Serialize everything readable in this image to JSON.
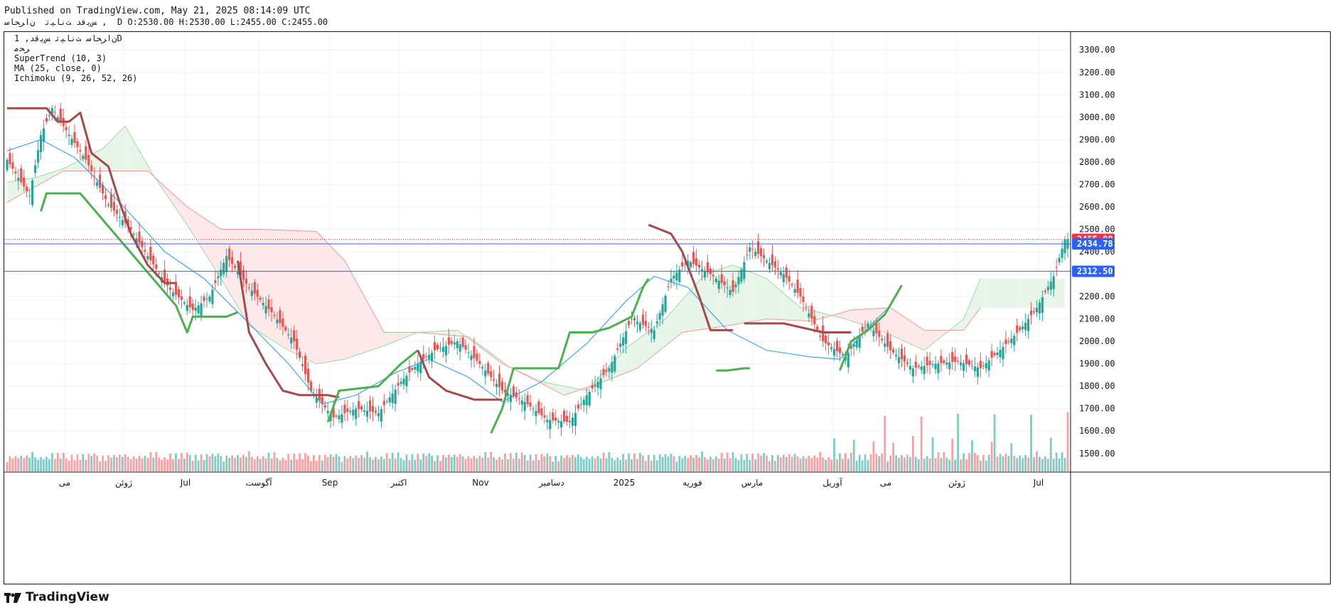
{
  "header": {
    "published": "Published on TradingView.com, May 21, 2025 08:14:09 UTC",
    "subline": "ﺲﯾﻗﺪ ﺖﻧﺎﯿﺗ  ﻥاﺮﺤﺎﺳ ,  D O:2530.00 H:2530.00 L:2455.00 C:2455.00"
  },
  "legend": {
    "symbol": "ﻥاﺮﺤﺎﺳ ﺖﻧﺎﯿﺗ ﺲﯾﻗﺪ, 1D",
    "exchange": "ﺮﺤﻣ",
    "supertrend": "SuperTrend (10, 3)",
    "ma": "MA (25, close, 0)",
    "ichimoku": "Ichimoku (9, 26, 52, 26)"
  },
  "brand": {
    "name": "TradingView"
  },
  "chart_data": {
    "type": "candlestick",
    "timeframe": "1D",
    "ylim": [
      1420,
      3380
    ],
    "y_ticks": [
      1500,
      1600,
      1700,
      1800,
      1900,
      2000,
      2100,
      2200,
      2300,
      2400,
      2500,
      2600,
      2700,
      2800,
      2900,
      3000,
      3100,
      3200,
      3300
    ],
    "x_month_labels": [
      "می",
      "ژوئن",
      "Jul",
      "آگوست",
      "Sep",
      "اکتبر",
      "Nov",
      "دسامبر",
      "2025",
      "فوریه",
      "مارس",
      "آوریل",
      "می",
      "ژوئن",
      "Jul"
    ],
    "price_labels": [
      {
        "value": 2455.0,
        "text": "2455.00",
        "color": "#f23645"
      },
      {
        "value": 2434.78,
        "text": "2434.78",
        "color": "#2962ff"
      },
      {
        "value": 2312.5,
        "text": "2312.50",
        "color": "#2962ff"
      }
    ],
    "horizontal_lines": [
      2434.78,
      2312.5
    ],
    "last_close": 2455.0,
    "ohlc_last": {
      "open": 2530.0,
      "high": 2530.0,
      "low": 2455.0,
      "close": 2455.0
    },
    "candle_close_path": [
      [
        0,
        2810
      ],
      [
        8,
        2650
      ],
      [
        12,
        2920
      ],
      [
        16,
        3040
      ],
      [
        20,
        2960
      ],
      [
        28,
        2810
      ],
      [
        36,
        2610
      ],
      [
        44,
        2500
      ],
      [
        50,
        2380
      ],
      [
        58,
        2230
      ],
      [
        66,
        2140
      ],
      [
        72,
        2200
      ],
      [
        78,
        2380
      ],
      [
        86,
        2240
      ],
      [
        94,
        2130
      ],
      [
        102,
        2000
      ],
      [
        108,
        1780
      ],
      [
        116,
        1660
      ],
      [
        124,
        1700
      ],
      [
        132,
        1680
      ],
      [
        140,
        1820
      ],
      [
        146,
        1900
      ],
      [
        152,
        1960
      ],
      [
        160,
        2000
      ],
      [
        168,
        1900
      ],
      [
        176,
        1780
      ],
      [
        184,
        1730
      ],
      [
        192,
        1650
      ],
      [
        200,
        1640
      ],
      [
        206,
        1760
      ],
      [
        214,
        1880
      ],
      [
        222,
        2100
      ],
      [
        230,
        2050
      ],
      [
        236,
        2280
      ],
      [
        242,
        2360
      ],
      [
        250,
        2300
      ],
      [
        258,
        2220
      ],
      [
        264,
        2420
      ],
      [
        270,
        2360
      ],
      [
        276,
        2300
      ],
      [
        282,
        2200
      ],
      [
        290,
        2000
      ],
      [
        298,
        1930
      ],
      [
        306,
        2080
      ],
      [
        314,
        1960
      ],
      [
        322,
        1880
      ],
      [
        330,
        1900
      ],
      [
        338,
        1910
      ],
      [
        346,
        1880
      ],
      [
        352,
        1950
      ],
      [
        360,
        2050
      ],
      [
        366,
        2150
      ],
      [
        372,
        2290
      ],
      [
        376,
        2455
      ]
    ],
    "candle_count": 378,
    "volume_ylim": [
      0,
      600
    ],
    "supertrend_segments": [
      {
        "trend": "down",
        "color": "#a44a4a",
        "points": [
          [
            0,
            3040
          ],
          [
            14,
            3040
          ],
          [
            18,
            2980
          ],
          [
            22,
            2980
          ],
          [
            26,
            3020
          ],
          [
            30,
            2840
          ],
          [
            36,
            2780
          ],
          [
            40,
            2620
          ],
          [
            44,
            2480
          ],
          [
            50,
            2340
          ],
          [
            56,
            2260
          ],
          [
            60,
            2260
          ]
        ]
      },
      {
        "trend": "up",
        "color": "#4caf50",
        "points": [
          [
            12,
            2580
          ],
          [
            14,
            2660
          ],
          [
            26,
            2660
          ],
          [
            60,
            2160
          ],
          [
            64,
            2040
          ],
          [
            66,
            2110
          ],
          [
            78,
            2110
          ],
          [
            82,
            2130
          ]
        ]
      },
      {
        "trend": "down",
        "color": "#a44a4a",
        "points": [
          [
            82,
            2360
          ],
          [
            86,
            2040
          ],
          [
            92,
            1900
          ],
          [
            98,
            1780
          ],
          [
            104,
            1760
          ],
          [
            114,
            1760
          ],
          [
            118,
            1750
          ]
        ]
      },
      {
        "trend": "up",
        "color": "#4caf50",
        "points": [
          [
            114,
            1640
          ],
          [
            118,
            1780
          ],
          [
            132,
            1800
          ],
          [
            140,
            1900
          ],
          [
            146,
            1960
          ]
        ]
      },
      {
        "trend": "down",
        "color": "#a44a4a",
        "points": [
          [
            146,
            1960
          ],
          [
            150,
            1840
          ],
          [
            156,
            1780
          ],
          [
            166,
            1740
          ],
          [
            176,
            1740
          ]
        ]
      },
      {
        "trend": "up",
        "color": "#4caf50",
        "points": [
          [
            172,
            1590
          ],
          [
            176,
            1700
          ],
          [
            180,
            1880
          ],
          [
            196,
            1880
          ],
          [
            200,
            2040
          ],
          [
            208,
            2040
          ],
          [
            214,
            2060
          ],
          [
            222,
            2110
          ],
          [
            226,
            2240
          ],
          [
            228,
            2280
          ]
        ]
      },
      {
        "trend": "down",
        "color": "#a44a4a",
        "points": [
          [
            228,
            2520
          ],
          [
            232,
            2500
          ],
          [
            236,
            2480
          ],
          [
            240,
            2400
          ],
          [
            246,
            2200
          ],
          [
            250,
            2050
          ],
          [
            258,
            2050
          ]
        ]
      },
      {
        "trend": "up",
        "color": "#4caf50",
        "points": [
          [
            252,
            1870
          ],
          [
            256,
            1870
          ],
          [
            262,
            1880
          ],
          [
            264,
            1880
          ]
        ]
      },
      {
        "trend": "down",
        "color": "#a44a4a",
        "points": [
          [
            262,
            2080
          ],
          [
            276,
            2080
          ],
          [
            290,
            2040
          ],
          [
            300,
            2040
          ]
        ]
      },
      {
        "trend": "up",
        "color": "#4caf50",
        "points": [
          [
            296,
            1870
          ],
          [
            300,
            2000
          ],
          [
            306,
            2050
          ],
          [
            312,
            2120
          ],
          [
            318,
            2250
          ]
        ]
      }
    ],
    "ma_path": [
      [
        0,
        2850
      ],
      [
        12,
        2900
      ],
      [
        24,
        2820
      ],
      [
        40,
        2620
      ],
      [
        56,
        2400
      ],
      [
        70,
        2280
      ],
      [
        86,
        2080
      ],
      [
        100,
        1900
      ],
      [
        112,
        1720
      ],
      [
        124,
        1760
      ],
      [
        138,
        1860
      ],
      [
        150,
        1920
      ],
      [
        164,
        1840
      ],
      [
        176,
        1730
      ],
      [
        190,
        1820
      ],
      [
        206,
        1990
      ],
      [
        220,
        2180
      ],
      [
        230,
        2290
      ],
      [
        242,
        2240
      ],
      [
        256,
        2050
      ],
      [
        270,
        1960
      ],
      [
        286,
        1930
      ],
      [
        296,
        1920
      ],
      [
        306,
        2060
      ],
      [
        314,
        2160
      ]
    ],
    "ichimoku_cloud": {
      "span_a": [
        [
          0,
          2710
        ],
        [
          10,
          2730
        ],
        [
          20,
          2770
        ],
        [
          34,
          2860
        ],
        [
          42,
          2960
        ],
        [
          52,
          2740
        ],
        [
          64,
          2520
        ],
        [
          76,
          2280
        ],
        [
          86,
          2070
        ],
        [
          100,
          1960
        ],
        [
          110,
          1900
        ],
        [
          120,
          1920
        ],
        [
          134,
          1980
        ],
        [
          146,
          2040
        ],
        [
          160,
          2050
        ],
        [
          176,
          1900
        ],
        [
          190,
          1820
        ],
        [
          206,
          1780
        ],
        [
          220,
          1970
        ],
        [
          234,
          2100
        ],
        [
          248,
          2300
        ],
        [
          258,
          2340
        ],
        [
          270,
          2280
        ],
        [
          282,
          2150
        ],
        [
          298,
          2100
        ],
        [
          312,
          2040
        ],
        [
          326,
          1960
        ],
        [
          340,
          2100
        ],
        [
          346,
          2280
        ]
      ],
      "span_b": [
        [
          0,
          2620
        ],
        [
          20,
          2760
        ],
        [
          50,
          2760
        ],
        [
          64,
          2600
        ],
        [
          76,
          2500
        ],
        [
          90,
          2500
        ],
        [
          110,
          2490
        ],
        [
          120,
          2360
        ],
        [
          134,
          2040
        ],
        [
          146,
          2040
        ],
        [
          164,
          2020
        ],
        [
          178,
          1890
        ],
        [
          198,
          1760
        ],
        [
          212,
          1820
        ],
        [
          224,
          1880
        ],
        [
          240,
          2040
        ],
        [
          256,
          2070
        ],
        [
          270,
          2100
        ],
        [
          286,
          2090
        ],
        [
          300,
          2140
        ],
        [
          314,
          2150
        ],
        [
          326,
          2050
        ],
        [
          340,
          2050
        ],
        [
          346,
          2150
        ]
      ]
    }
  },
  "colors": {
    "bull": "#26a69a",
    "bear": "#ef5350",
    "bull_volume": "#80cbc4",
    "bear_volume": "#f7a1a4",
    "ma": "#2196f3",
    "grid": "#f0f3fa",
    "cloud_bull": "#e8f5e9",
    "cloud_bear": "#fde9e9"
  }
}
